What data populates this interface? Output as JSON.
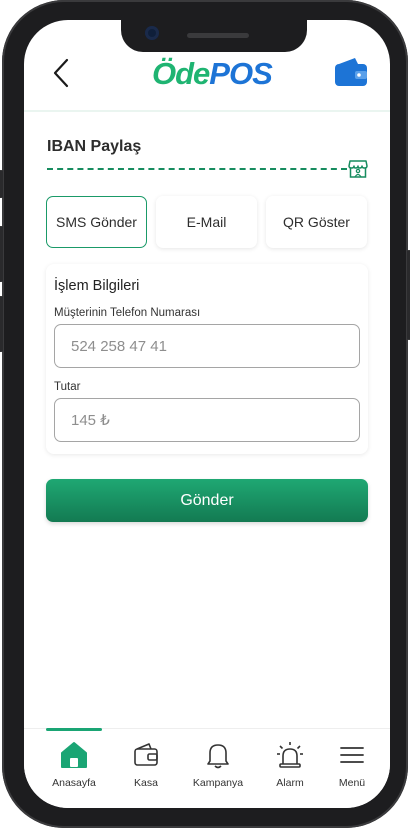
{
  "header": {
    "logo_part1": "Öde",
    "logo_part2": "POS"
  },
  "page": {
    "title": "IBAN Paylaş"
  },
  "tabs": [
    {
      "label": "SMS Gönder",
      "active": true
    },
    {
      "label": "E-Mail",
      "active": false
    },
    {
      "label": "QR Göster",
      "active": false
    }
  ],
  "form": {
    "section_title": "İşlem Bilgileri",
    "phone_label": "Müşterinin Telefon Numarası",
    "phone_value": "524 258 47 41",
    "amount_label": "Tutar",
    "amount_value": "145 ₺",
    "submit_label": "Gönder"
  },
  "bottom_nav": {
    "active": "home",
    "items": [
      {
        "label": "Anasayfa",
        "icon": "home-icon"
      },
      {
        "label": "Kasa",
        "icon": "wallet-icon"
      },
      {
        "label": "Kampanya",
        "icon": "bell-icon"
      },
      {
        "label": "Alarm",
        "icon": "siren-icon"
      },
      {
        "label": "Menü",
        "icon": "hamburger-menu-icon"
      }
    ]
  },
  "colors": {
    "brand_green": "#1fb472",
    "brand_blue": "#1d74d6",
    "accent_green": "#1a9a68"
  }
}
